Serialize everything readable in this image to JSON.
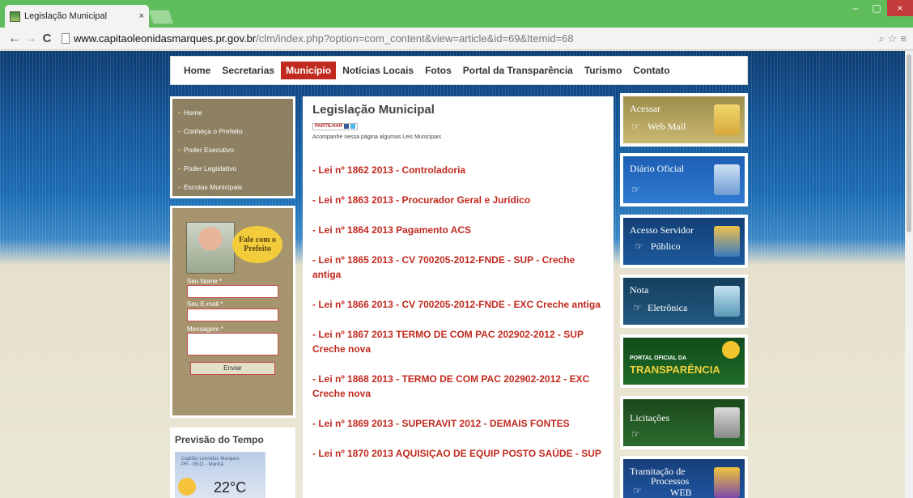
{
  "browser": {
    "tab_title": "Legislação Municipal",
    "tab_close": "×",
    "url_domain": "www.capitaoleonidasmarques.pr.gov.br",
    "url_path": "/clm/index.php?option=com_content&view=article&id=69&Itemid=68",
    "back": "←",
    "forward": "→",
    "reload": "C",
    "zoom_icon": "⌕",
    "star_icon": "☆",
    "menu_icon": "≡",
    "win_min": "–",
    "win_max": "▢",
    "win_close": "×"
  },
  "menu": {
    "items": [
      {
        "label": "Home"
      },
      {
        "label": "Secretarias"
      },
      {
        "label": "Município"
      },
      {
        "label": "Notícias Locais"
      },
      {
        "label": "Fotos"
      },
      {
        "label": "Portal da Transparência"
      },
      {
        "label": "Turismo"
      },
      {
        "label": "Contato"
      }
    ]
  },
  "leftnav": {
    "items": [
      {
        "label": "Home"
      },
      {
        "label": "Conheça o Prefeito"
      },
      {
        "label": "Poder Executivo"
      },
      {
        "label": "Poder Legislativo"
      },
      {
        "label": "Escolas Municipais"
      }
    ]
  },
  "contact": {
    "bubble_line1": "Fale com o",
    "bubble_line2": "Prefeito",
    "name_label": "Seu Nome *",
    "email_label": "Seu E-mail *",
    "message_label": "Mensagem *",
    "submit_label": "Enviar"
  },
  "weather": {
    "title": "Previsão do Tempo",
    "city_line1": "Capitão Leonidas Marques",
    "city_line2": "PR - 05/11 - Manhã",
    "temperature": "22°C"
  },
  "content": {
    "title": "Legislação Municipal",
    "share_label": "PARTILHAR",
    "intro": "Acompanhe nessa página algumas Leis Municipais",
    "laws": [
      {
        "label": "- Lei nº 1862 2013 - Controladoria"
      },
      {
        "label": "- Lei nº 1863 2013 - Procurador Geral e Jurídico"
      },
      {
        "label": "- Lei nº 1864 2013 Pagamento ACS"
      },
      {
        "label": "- Lei nº 1865 2013 - CV 700205-2012-FNDE - SUP - Creche antiga"
      },
      {
        "label": "- Lei nº 1866 2013 - CV 700205-2012-FNDE - EXC Creche antiga"
      },
      {
        "label": "- Lei nº 1867 2013 TERMO DE COM PAC 202902-2012 - SUP Creche nova"
      },
      {
        "label": "- Lei nº 1868 2013 - TERMO DE COM PAC 202902-2012 - EXC Creche nova"
      },
      {
        "label": "- Lei nº 1869 2013 - SUPERAVIT 2012 - DEMAIS FONTES"
      },
      {
        "label": "- Lei nº 1870 2013 AQUISIÇAO DE EQUIP POSTO SAÚDE - SUP"
      }
    ]
  },
  "banners": {
    "webmail_title": "Acessar",
    "webmail_sub": "Web Mail",
    "diario_title": "Diário Oficial",
    "servidor_title": "Acesso Servidor",
    "servidor_sub": "Público",
    "nota_title": "Nota",
    "nota_sub": "Eletrônica",
    "transp_small": "PORTAL OFICIAL DA",
    "transp_big": "TRANSPARÊNCIA",
    "licitacoes_title": "Licitações",
    "tramitacao_title": "Tramitação de",
    "tramitacao_sub": "Processos",
    "tramitacao_sub2": "WEB"
  },
  "colors": {
    "accent_red": "#c12a1f",
    "leftnav_bg": "#8e8163",
    "browser_green": "#5fbe5b"
  }
}
